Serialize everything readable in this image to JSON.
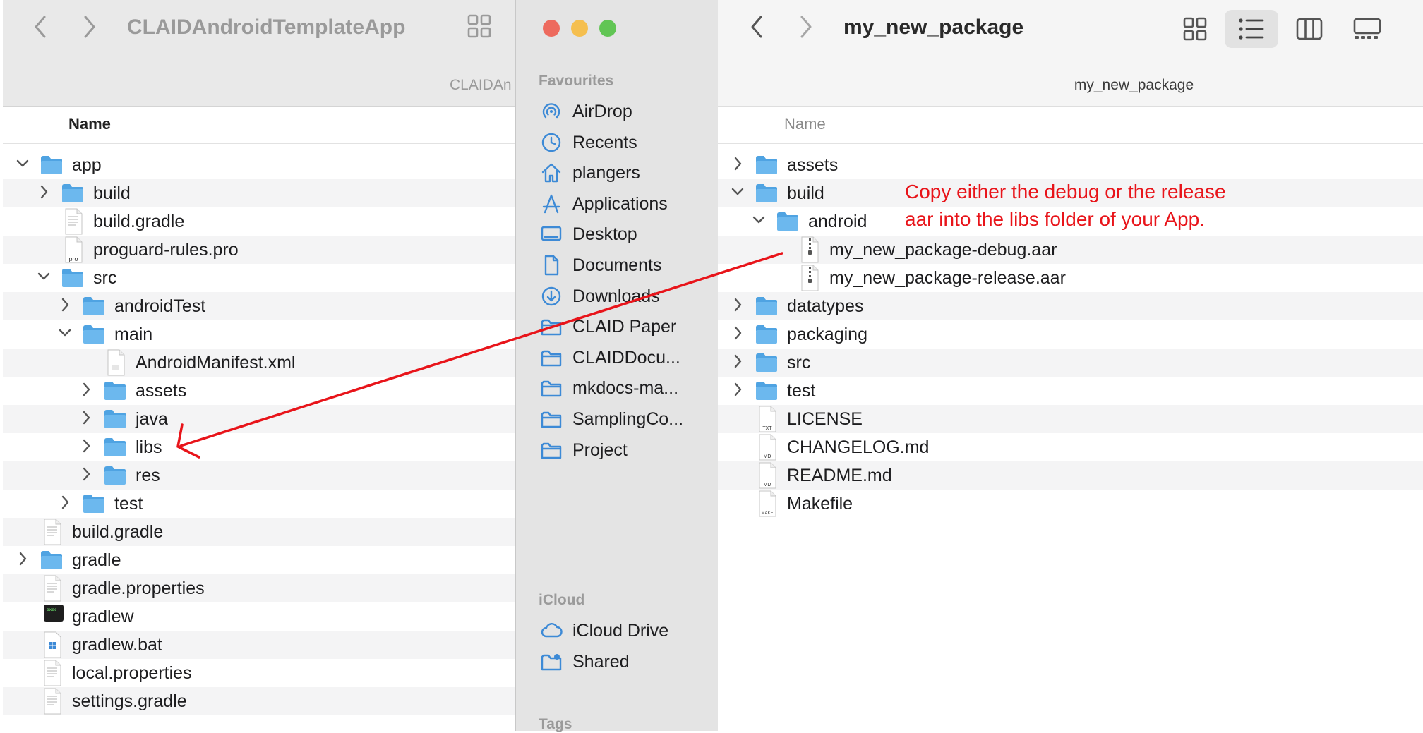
{
  "left_window": {
    "title": "CLAIDAndroidTemplateApp",
    "path_label": "CLAIDAn",
    "column_header": "Name",
    "rows": [
      {
        "label": "app",
        "type": "folder",
        "depth": 0,
        "chevron": "down"
      },
      {
        "label": "build",
        "type": "folder",
        "depth": 1,
        "chevron": "right"
      },
      {
        "label": "build.gradle",
        "type": "file",
        "depth": 1,
        "chevron": "none"
      },
      {
        "label": "proguard-rules.pro",
        "type": "pro",
        "depth": 1,
        "chevron": "none"
      },
      {
        "label": "src",
        "type": "folder",
        "depth": 1,
        "chevron": "down"
      },
      {
        "label": "androidTest",
        "type": "folder",
        "depth": 2,
        "chevron": "right"
      },
      {
        "label": "main",
        "type": "folder",
        "depth": 2,
        "chevron": "down"
      },
      {
        "label": "AndroidManifest.xml",
        "type": "xml",
        "depth": 3,
        "chevron": "none"
      },
      {
        "label": "assets",
        "type": "folder",
        "depth": 3,
        "chevron": "right"
      },
      {
        "label": "java",
        "type": "folder",
        "depth": 3,
        "chevron": "right"
      },
      {
        "label": "libs",
        "type": "folder",
        "depth": 3,
        "chevron": "right"
      },
      {
        "label": "res",
        "type": "folder",
        "depth": 3,
        "chevron": "right"
      },
      {
        "label": "test",
        "type": "folder",
        "depth": 2,
        "chevron": "right"
      },
      {
        "label": "build.gradle",
        "type": "file",
        "depth": 0,
        "chevron": "none"
      },
      {
        "label": "gradle",
        "type": "folder",
        "depth": 0,
        "chevron": "right"
      },
      {
        "label": "gradle.properties",
        "type": "file",
        "depth": 0,
        "chevron": "none"
      },
      {
        "label": "gradlew",
        "type": "exec",
        "depth": 0,
        "chevron": "none"
      },
      {
        "label": "gradlew.bat",
        "type": "bat",
        "depth": 0,
        "chevron": "none"
      },
      {
        "label": "local.properties",
        "type": "file",
        "depth": 0,
        "chevron": "none"
      },
      {
        "label": "settings.gradle",
        "type": "file",
        "depth": 0,
        "chevron": "none"
      }
    ]
  },
  "sidebar": {
    "favourites_heading": "Favourites",
    "favourites": [
      {
        "label": "AirDrop",
        "icon": "airdrop-icon"
      },
      {
        "label": "Recents",
        "icon": "clock-icon"
      },
      {
        "label": "plangers",
        "icon": "home-icon"
      },
      {
        "label": "Applications",
        "icon": "applications-icon"
      },
      {
        "label": "Desktop",
        "icon": "desktop-icon"
      },
      {
        "label": "Documents",
        "icon": "document-icon"
      },
      {
        "label": "Downloads",
        "icon": "download-icon"
      },
      {
        "label": "CLAID Paper",
        "icon": "folder-icon"
      },
      {
        "label": "CLAIDDocu...",
        "icon": "folder-icon"
      },
      {
        "label": "mkdocs-ma...",
        "icon": "folder-icon"
      },
      {
        "label": "SamplingCo...",
        "icon": "folder-icon"
      },
      {
        "label": "Project",
        "icon": "folder-icon"
      }
    ],
    "icloud_heading": "iCloud",
    "icloud": [
      {
        "label": "iCloud Drive",
        "icon": "cloud-icon"
      },
      {
        "label": "Shared",
        "icon": "shared-folder-icon"
      }
    ],
    "tags_heading": "Tags"
  },
  "right_window": {
    "title": "my_new_package",
    "path_label": "my_new_package",
    "column_header": "Name",
    "rows": [
      {
        "label": "assets",
        "type": "folder",
        "depth": 0,
        "chevron": "right"
      },
      {
        "label": "build",
        "type": "folder",
        "depth": 0,
        "chevron": "down"
      },
      {
        "label": "android",
        "type": "folder",
        "depth": 1,
        "chevron": "down"
      },
      {
        "label": "my_new_package-debug.aar",
        "type": "zip",
        "depth": 2,
        "chevron": "none"
      },
      {
        "label": "my_new_package-release.aar",
        "type": "zip",
        "depth": 2,
        "chevron": "none"
      },
      {
        "label": "datatypes",
        "type": "folder",
        "depth": 0,
        "chevron": "right"
      },
      {
        "label": "packaging",
        "type": "folder",
        "depth": 0,
        "chevron": "right"
      },
      {
        "label": "src",
        "type": "folder",
        "depth": 0,
        "chevron": "right"
      },
      {
        "label": "test",
        "type": "folder",
        "depth": 0,
        "chevron": "right"
      },
      {
        "label": "LICENSE",
        "type": "txt",
        "depth": 0,
        "chevron": "none"
      },
      {
        "label": "CHANGELOG.md",
        "type": "md",
        "depth": 0,
        "chevron": "none"
      },
      {
        "label": "README.md",
        "type": "md",
        "depth": 0,
        "chevron": "none"
      },
      {
        "label": "Makefile",
        "type": "make",
        "depth": 0,
        "chevron": "none"
      }
    ]
  },
  "annotation": {
    "line1": "Copy either the debug or the release",
    "line2": "aar into the libs folder of your App.",
    "color": "#e8141a"
  },
  "colors": {
    "folder": "#6cb8ee",
    "folder_tab": "#4fa3e2",
    "accent": "#3d8ad6",
    "traffic_red": "#ed6a5e",
    "traffic_yellow": "#f5bf4f",
    "traffic_green": "#61c554"
  }
}
